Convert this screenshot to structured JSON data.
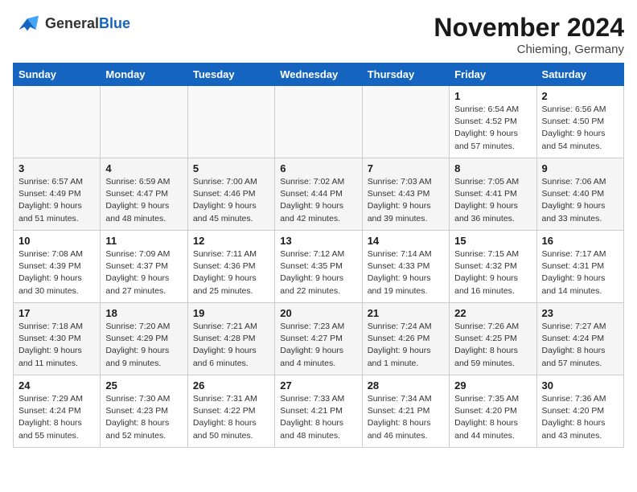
{
  "header": {
    "logo_general": "General",
    "logo_blue": "Blue",
    "month": "November 2024",
    "location": "Chieming, Germany"
  },
  "days_of_week": [
    "Sunday",
    "Monday",
    "Tuesday",
    "Wednesday",
    "Thursday",
    "Friday",
    "Saturday"
  ],
  "weeks": [
    [
      {
        "day": "",
        "empty": true
      },
      {
        "day": "",
        "empty": true
      },
      {
        "day": "",
        "empty": true
      },
      {
        "day": "",
        "empty": true
      },
      {
        "day": "",
        "empty": true
      },
      {
        "day": "1",
        "sunrise": "Sunrise: 6:54 AM",
        "sunset": "Sunset: 4:52 PM",
        "daylight": "Daylight: 9 hours and 57 minutes."
      },
      {
        "day": "2",
        "sunrise": "Sunrise: 6:56 AM",
        "sunset": "Sunset: 4:50 PM",
        "daylight": "Daylight: 9 hours and 54 minutes."
      }
    ],
    [
      {
        "day": "3",
        "sunrise": "Sunrise: 6:57 AM",
        "sunset": "Sunset: 4:49 PM",
        "daylight": "Daylight: 9 hours and 51 minutes."
      },
      {
        "day": "4",
        "sunrise": "Sunrise: 6:59 AM",
        "sunset": "Sunset: 4:47 PM",
        "daylight": "Daylight: 9 hours and 48 minutes."
      },
      {
        "day": "5",
        "sunrise": "Sunrise: 7:00 AM",
        "sunset": "Sunset: 4:46 PM",
        "daylight": "Daylight: 9 hours and 45 minutes."
      },
      {
        "day": "6",
        "sunrise": "Sunrise: 7:02 AM",
        "sunset": "Sunset: 4:44 PM",
        "daylight": "Daylight: 9 hours and 42 minutes."
      },
      {
        "day": "7",
        "sunrise": "Sunrise: 7:03 AM",
        "sunset": "Sunset: 4:43 PM",
        "daylight": "Daylight: 9 hours and 39 minutes."
      },
      {
        "day": "8",
        "sunrise": "Sunrise: 7:05 AM",
        "sunset": "Sunset: 4:41 PM",
        "daylight": "Daylight: 9 hours and 36 minutes."
      },
      {
        "day": "9",
        "sunrise": "Sunrise: 7:06 AM",
        "sunset": "Sunset: 4:40 PM",
        "daylight": "Daylight: 9 hours and 33 minutes."
      }
    ],
    [
      {
        "day": "10",
        "sunrise": "Sunrise: 7:08 AM",
        "sunset": "Sunset: 4:39 PM",
        "daylight": "Daylight: 9 hours and 30 minutes."
      },
      {
        "day": "11",
        "sunrise": "Sunrise: 7:09 AM",
        "sunset": "Sunset: 4:37 PM",
        "daylight": "Daylight: 9 hours and 27 minutes."
      },
      {
        "day": "12",
        "sunrise": "Sunrise: 7:11 AM",
        "sunset": "Sunset: 4:36 PM",
        "daylight": "Daylight: 9 hours and 25 minutes."
      },
      {
        "day": "13",
        "sunrise": "Sunrise: 7:12 AM",
        "sunset": "Sunset: 4:35 PM",
        "daylight": "Daylight: 9 hours and 22 minutes."
      },
      {
        "day": "14",
        "sunrise": "Sunrise: 7:14 AM",
        "sunset": "Sunset: 4:33 PM",
        "daylight": "Daylight: 9 hours and 19 minutes."
      },
      {
        "day": "15",
        "sunrise": "Sunrise: 7:15 AM",
        "sunset": "Sunset: 4:32 PM",
        "daylight": "Daylight: 9 hours and 16 minutes."
      },
      {
        "day": "16",
        "sunrise": "Sunrise: 7:17 AM",
        "sunset": "Sunset: 4:31 PM",
        "daylight": "Daylight: 9 hours and 14 minutes."
      }
    ],
    [
      {
        "day": "17",
        "sunrise": "Sunrise: 7:18 AM",
        "sunset": "Sunset: 4:30 PM",
        "daylight": "Daylight: 9 hours and 11 minutes."
      },
      {
        "day": "18",
        "sunrise": "Sunrise: 7:20 AM",
        "sunset": "Sunset: 4:29 PM",
        "daylight": "Daylight: 9 hours and 9 minutes."
      },
      {
        "day": "19",
        "sunrise": "Sunrise: 7:21 AM",
        "sunset": "Sunset: 4:28 PM",
        "daylight": "Daylight: 9 hours and 6 minutes."
      },
      {
        "day": "20",
        "sunrise": "Sunrise: 7:23 AM",
        "sunset": "Sunset: 4:27 PM",
        "daylight": "Daylight: 9 hours and 4 minutes."
      },
      {
        "day": "21",
        "sunrise": "Sunrise: 7:24 AM",
        "sunset": "Sunset: 4:26 PM",
        "daylight": "Daylight: 9 hours and 1 minute."
      },
      {
        "day": "22",
        "sunrise": "Sunrise: 7:26 AM",
        "sunset": "Sunset: 4:25 PM",
        "daylight": "Daylight: 8 hours and 59 minutes."
      },
      {
        "day": "23",
        "sunrise": "Sunrise: 7:27 AM",
        "sunset": "Sunset: 4:24 PM",
        "daylight": "Daylight: 8 hours and 57 minutes."
      }
    ],
    [
      {
        "day": "24",
        "sunrise": "Sunrise: 7:29 AM",
        "sunset": "Sunset: 4:24 PM",
        "daylight": "Daylight: 8 hours and 55 minutes."
      },
      {
        "day": "25",
        "sunrise": "Sunrise: 7:30 AM",
        "sunset": "Sunset: 4:23 PM",
        "daylight": "Daylight: 8 hours and 52 minutes."
      },
      {
        "day": "26",
        "sunrise": "Sunrise: 7:31 AM",
        "sunset": "Sunset: 4:22 PM",
        "daylight": "Daylight: 8 hours and 50 minutes."
      },
      {
        "day": "27",
        "sunrise": "Sunrise: 7:33 AM",
        "sunset": "Sunset: 4:21 PM",
        "daylight": "Daylight: 8 hours and 48 minutes."
      },
      {
        "day": "28",
        "sunrise": "Sunrise: 7:34 AM",
        "sunset": "Sunset: 4:21 PM",
        "daylight": "Daylight: 8 hours and 46 minutes."
      },
      {
        "day": "29",
        "sunrise": "Sunrise: 7:35 AM",
        "sunset": "Sunset: 4:20 PM",
        "daylight": "Daylight: 8 hours and 44 minutes."
      },
      {
        "day": "30",
        "sunrise": "Sunrise: 7:36 AM",
        "sunset": "Sunset: 4:20 PM",
        "daylight": "Daylight: 8 hours and 43 minutes."
      }
    ]
  ]
}
